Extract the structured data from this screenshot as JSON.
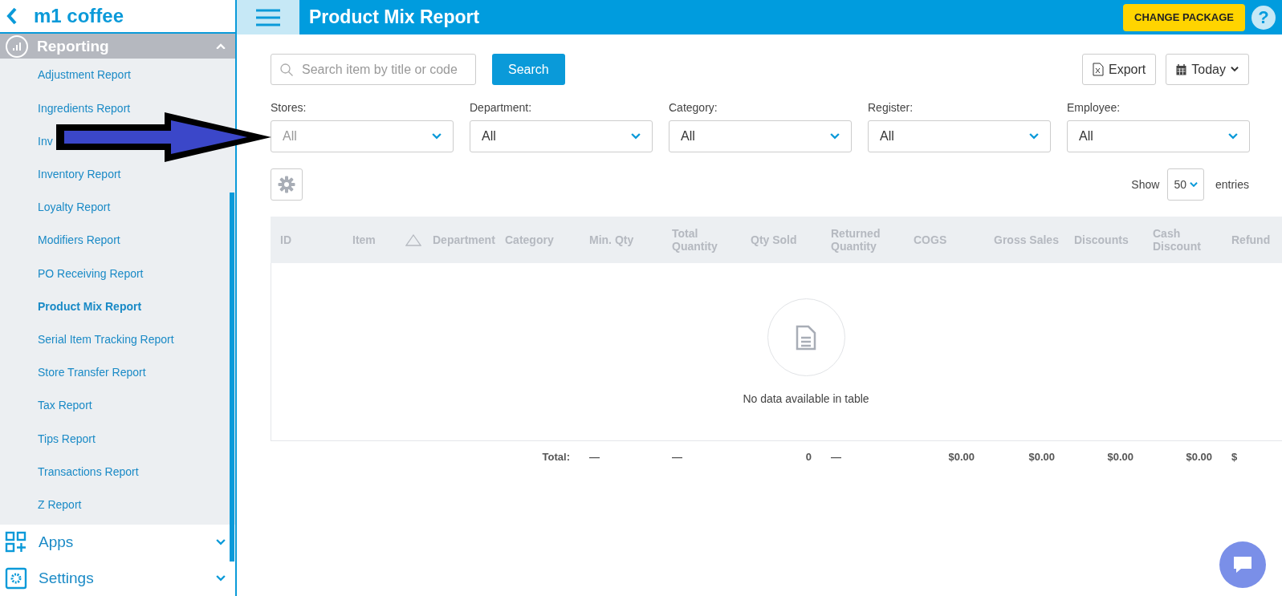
{
  "sidebar": {
    "brand": "m1 coffee",
    "section": {
      "label": "Reporting",
      "expanded": true
    },
    "items": [
      {
        "label": "Adjustment Report",
        "selected": false
      },
      {
        "label": "Ingredients Report",
        "selected": false
      },
      {
        "label": "Inv",
        "selected": false
      },
      {
        "label": "Inventory Report",
        "selected": false
      },
      {
        "label": "Loyalty Report",
        "selected": false
      },
      {
        "label": "Modifiers Report",
        "selected": false
      },
      {
        "label": "PO Receiving Report",
        "selected": false
      },
      {
        "label": "Product Mix Report",
        "selected": true
      },
      {
        "label": "Serial Item Tracking Report",
        "selected": false
      },
      {
        "label": "Store Transfer Report",
        "selected": false
      },
      {
        "label": "Tax Report",
        "selected": false
      },
      {
        "label": "Tips Report",
        "selected": false
      },
      {
        "label": "Transactions Report",
        "selected": false
      },
      {
        "label": "Z Report",
        "selected": false
      }
    ],
    "groups": [
      {
        "kind": "apps",
        "label": "Apps",
        "expanded": false
      },
      {
        "kind": "settings",
        "label": "Settings",
        "expanded": false
      }
    ]
  },
  "header": {
    "title": "Product Mix Report",
    "action": "CHANGE PACKAGE",
    "help": "?"
  },
  "toolbar": {
    "search_placeholder": "Search item by title or code",
    "search_button": "Search",
    "export": "Export",
    "date": "Today"
  },
  "filters": [
    {
      "label": "Stores:",
      "placeholder": "All"
    },
    {
      "label": "Department:",
      "value": "All"
    },
    {
      "label": "Category:",
      "value": "All"
    },
    {
      "label": "Register:",
      "value": "All"
    },
    {
      "label": "Employee:",
      "value": "All"
    }
  ],
  "entries": {
    "show": "Show",
    "value": "50",
    "suffix": "entries"
  },
  "table": {
    "columns": [
      {
        "kind": "text",
        "label": "ID"
      },
      {
        "kind": "text",
        "label": "Item"
      },
      {
        "kind": "sort"
      },
      {
        "kind": "text",
        "label": "Department"
      },
      {
        "kind": "text",
        "label": "Category"
      },
      {
        "kind": "text",
        "label": "Min. Qty"
      },
      {
        "kind": "text",
        "label": "Total Quantity"
      },
      {
        "kind": "text",
        "label": "Qty Sold"
      },
      {
        "kind": "text",
        "label": "Returned Quantity"
      },
      {
        "kind": "text",
        "label": "COGS"
      },
      {
        "kind": "text",
        "label": "Gross Sales"
      },
      {
        "kind": "text",
        "label": "Discounts"
      },
      {
        "kind": "text",
        "label": "Cash Discount"
      },
      {
        "kind": "text",
        "label": "Refund"
      }
    ],
    "empty_message": "No data available in table",
    "totals": {
      "label": "Total:",
      "values": [
        "—",
        "—",
        "0",
        "—",
        "$0.00",
        "$0.00",
        "$0.00",
        "$0.00",
        "$"
      ]
    }
  }
}
